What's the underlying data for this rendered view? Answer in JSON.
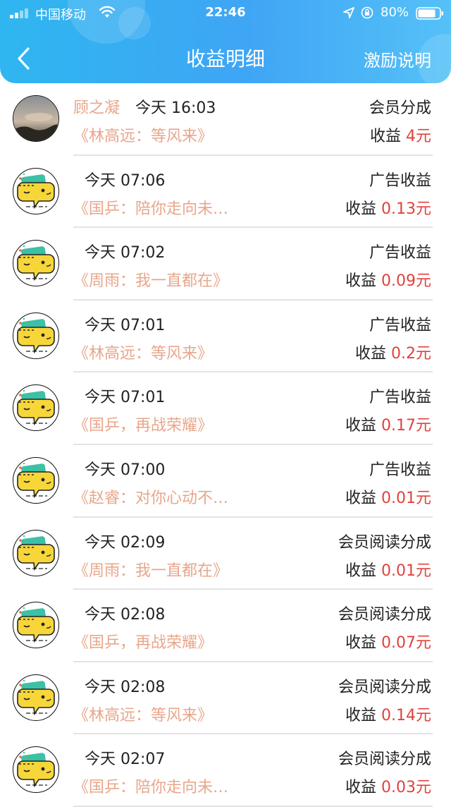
{
  "status_bar": {
    "carrier": "中国移动",
    "time": "22:46",
    "battery": "80%"
  },
  "header": {
    "title": "收益明细",
    "right_link": "激励说明"
  },
  "records": [
    {
      "name": "顾之凝",
      "time": "今天 16:03",
      "book": "《林高远：等风来》",
      "type": "会员分成",
      "amount_label": "收益",
      "amount": "4元",
      "avatar": "photo"
    },
    {
      "name": "",
      "time": "今天 07:06",
      "book": "《国乒：陪你走向未…",
      "type": "广告收益",
      "amount_label": "收益",
      "amount": "0.13元",
      "avatar": "mascot"
    },
    {
      "name": "",
      "time": "今天 07:02",
      "book": "《周雨：我一直都在》",
      "type": "广告收益",
      "amount_label": "收益",
      "amount": "0.09元",
      "avatar": "mascot"
    },
    {
      "name": "",
      "time": "今天 07:01",
      "book": "《林高远：等风来》",
      "type": "广告收益",
      "amount_label": "收益",
      "amount": "0.2元",
      "avatar": "mascot"
    },
    {
      "name": "",
      "time": "今天 07:01",
      "book": "《国乒，再战荣耀》",
      "type": "广告收益",
      "amount_label": "收益",
      "amount": "0.17元",
      "avatar": "mascot"
    },
    {
      "name": "",
      "time": "今天 07:00",
      "book": "《赵睿：对你心动不…",
      "type": "广告收益",
      "amount_label": "收益",
      "amount": "0.01元",
      "avatar": "mascot"
    },
    {
      "name": "",
      "time": "今天 02:09",
      "book": "《周雨：我一直都在》",
      "type": "会员阅读分成",
      "amount_label": "收益",
      "amount": "0.01元",
      "avatar": "mascot"
    },
    {
      "name": "",
      "time": "今天 02:08",
      "book": "《国乒，再战荣耀》",
      "type": "会员阅读分成",
      "amount_label": "收益",
      "amount": "0.07元",
      "avatar": "mascot"
    },
    {
      "name": "",
      "time": "今天 02:08",
      "book": "《林高远：等风来》",
      "type": "会员阅读分成",
      "amount_label": "收益",
      "amount": "0.14元",
      "avatar": "mascot"
    },
    {
      "name": "",
      "time": "今天 02:07",
      "book": "《国乒：陪你走向未…",
      "type": "会员阅读分成",
      "amount_label": "收益",
      "amount": "0.03元",
      "avatar": "mascot"
    }
  ],
  "colors": {
    "header_gradient_start": "#2fb6f0",
    "header_gradient_end": "#55c1f7",
    "amount_red": "#e0423e",
    "book_title_orange": "#e8a68b"
  }
}
